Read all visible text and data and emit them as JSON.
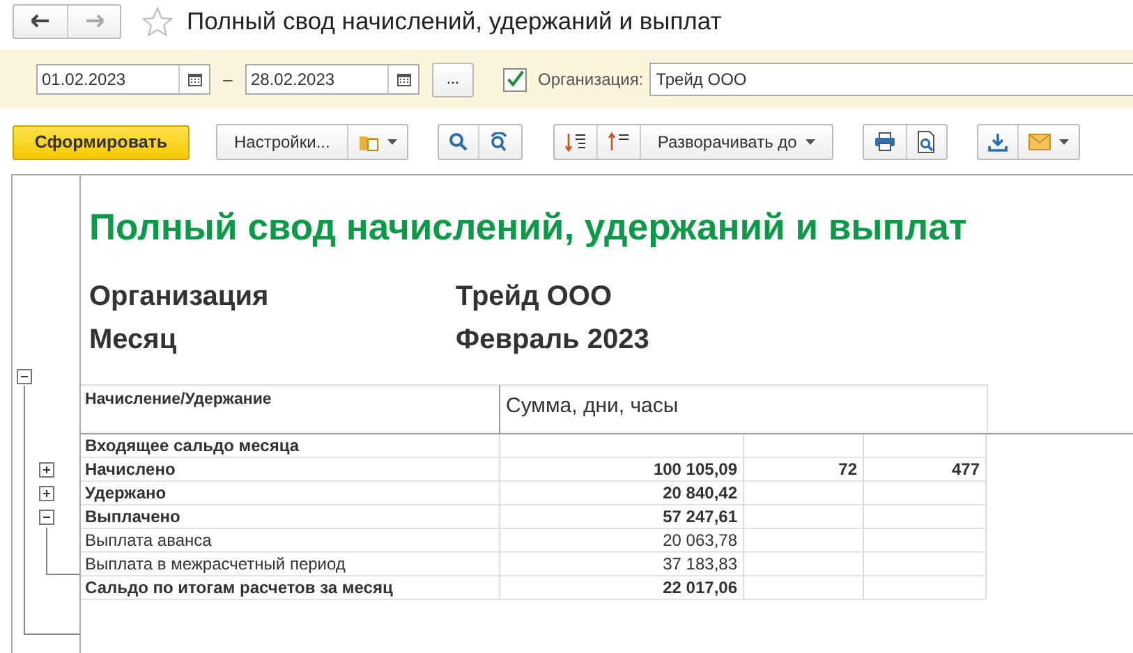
{
  "window": {
    "title": "Полный свод начислений, удержаний и выплат"
  },
  "filters": {
    "date_from": "01.02.2023",
    "separator": "–",
    "date_to": "28.02.2023",
    "more_button": "...",
    "organization_enabled": true,
    "organization_label": "Организация:",
    "organization": "Трейд ООО"
  },
  "toolbar": {
    "generate": "Сформировать",
    "settings": "Настройки...",
    "expand_to": "Разворачивать до"
  },
  "report": {
    "title": "Полный свод начислений, удержаний и выплат",
    "expanded": true,
    "params": [
      {
        "label": "Организация",
        "value": "Трейд ООО"
      },
      {
        "label": "Месяц",
        "value": "Февраль 2023"
      }
    ],
    "column_header": "Начисление/Удержание",
    "values_header": "Сумма, дни, часы",
    "rows": [
      {
        "kind": "total",
        "name": "Входящее сальдо месяца"
      },
      {
        "kind": "group",
        "expanded": false,
        "name": "Начислено",
        "sum": "100 105,09",
        "days": "72",
        "hours": "477"
      },
      {
        "kind": "group",
        "expanded": false,
        "name": "Удержано",
        "sum": "20 840,42"
      },
      {
        "kind": "group",
        "expanded": true,
        "name": "Выплачено",
        "sum": "57 247,61"
      },
      {
        "kind": "item",
        "name": "Выплата аванса",
        "sum": "20 063,78"
      },
      {
        "kind": "item",
        "name": "Выплата в межрасчетный период",
        "sum": "37 183,83"
      },
      {
        "kind": "total",
        "name": "Сальдо по итогам расчетов за месяц",
        "sum": "22 017,06"
      }
    ]
  }
}
